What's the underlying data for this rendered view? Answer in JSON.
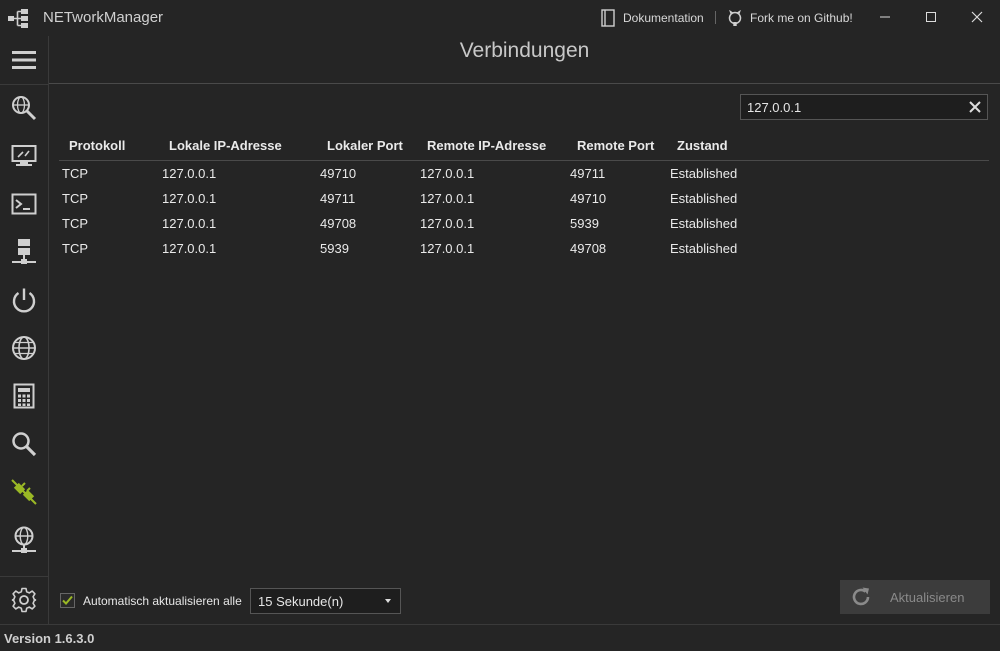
{
  "app": {
    "title": "NETworkManager",
    "version": "Version 1.6.3.0",
    "accent_color": "#9ab825"
  },
  "titlebar": {
    "documentation_label": "Dokumentation",
    "github_label": "Fork me on Github!",
    "icons": [
      "app-logo-icon",
      "book-icon",
      "github-icon",
      "minimize-icon",
      "maximize-icon",
      "close-icon"
    ]
  },
  "sidebar": {
    "items": [
      {
        "name": "menu",
        "icon": "hamburger-menu-icon"
      },
      {
        "name": "ip-scanner",
        "icon": "globe-search-icon"
      },
      {
        "name": "remote-desktop",
        "icon": "monitor-icon"
      },
      {
        "name": "putty",
        "icon": "terminal-icon"
      },
      {
        "name": "network-interface",
        "icon": "server-network-icon"
      },
      {
        "name": "wake-on-lan",
        "icon": "power-icon"
      },
      {
        "name": "http-headers",
        "icon": "globe-icon"
      },
      {
        "name": "subnet-calculator",
        "icon": "calculator-icon"
      },
      {
        "name": "lookup",
        "icon": "search-icon"
      },
      {
        "name": "connections",
        "icon": "plug-icon",
        "active": true
      },
      {
        "name": "listeners",
        "icon": "globe-network-icon"
      },
      {
        "name": "settings",
        "icon": "gear-icon"
      }
    ]
  },
  "page": {
    "title": "Verbindungen"
  },
  "search": {
    "value": "127.0.0.1"
  },
  "table": {
    "columns": [
      "Protokoll",
      "Lokale IP-Adresse",
      "Lokaler Port",
      "Remote IP-Adresse",
      "Remote Port",
      "Zustand"
    ],
    "rows": [
      [
        "TCP",
        "127.0.0.1",
        "49710",
        "127.0.0.1",
        "49711",
        "Established"
      ],
      [
        "TCP",
        "127.0.0.1",
        "49711",
        "127.0.0.1",
        "49710",
        "Established"
      ],
      [
        "TCP",
        "127.0.0.1",
        "49708",
        "127.0.0.1",
        "5939",
        "Established"
      ],
      [
        "TCP",
        "127.0.0.1",
        "5939",
        "127.0.0.1",
        "49708",
        "Established"
      ]
    ]
  },
  "footer": {
    "auto_refresh_checked": true,
    "auto_refresh_label": "Automatisch aktualisieren alle",
    "interval_selected": "15 Sekunde(n)",
    "refresh_button_label": "Aktualisieren",
    "refresh_enabled": false
  }
}
